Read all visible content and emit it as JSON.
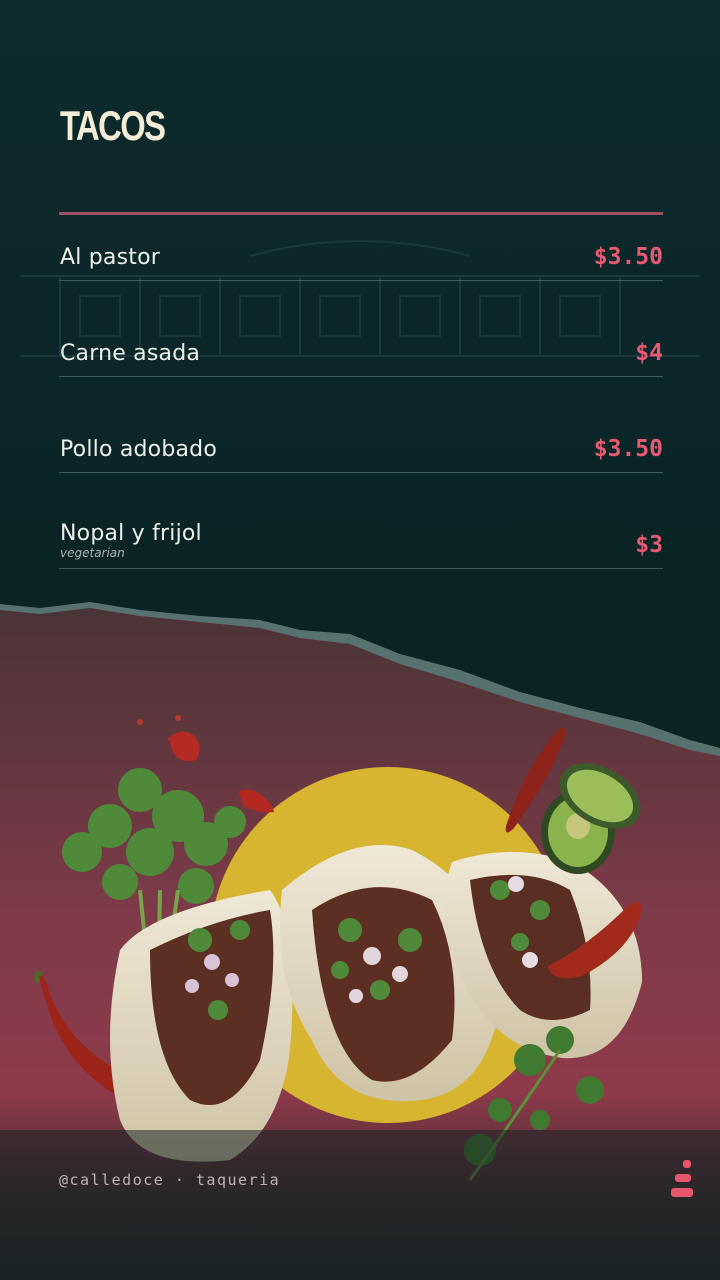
{
  "menu": {
    "title": "TACOS",
    "items": [
      {
        "name": "Al pastor",
        "note": "",
        "price": "$3.50"
      },
      {
        "name": "Carne asada",
        "note": "",
        "price": "$4"
      },
      {
        "name": "Pollo adobado",
        "note": "",
        "price": "$3.50"
      },
      {
        "name": "Nopal y frijol",
        "note": "vegetarian",
        "price": "$3"
      }
    ]
  },
  "footer": {
    "handle": "@calledoce · taqueria",
    "logo_icon": "stacked-bars-logo-icon"
  },
  "colors": {
    "background": "#0b2628",
    "accent": "#e65a72",
    "title": "#f4ecd6",
    "rule": "#a0505e",
    "sun": "#d8b531"
  }
}
